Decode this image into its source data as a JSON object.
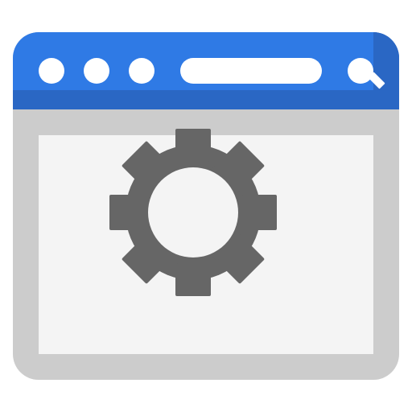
{
  "window": {
    "title_bar": {
      "controls": [
        {
          "name": "window-control-1",
          "icon": "circle"
        },
        {
          "name": "window-control-2",
          "icon": "circle"
        },
        {
          "name": "window-control-3",
          "icon": "circle"
        }
      ],
      "address_bar": {
        "text": ""
      },
      "search": {
        "icon": "search-icon"
      }
    },
    "content": {
      "icon": "gear-icon"
    }
  },
  "colors": {
    "title_bar": "#2f7ae5",
    "title_bar_shade": "#2a67c4",
    "frame": "#cccccc",
    "content_background": "#f4f4f4",
    "gear": "#666666",
    "foreground": "#ffffff"
  }
}
